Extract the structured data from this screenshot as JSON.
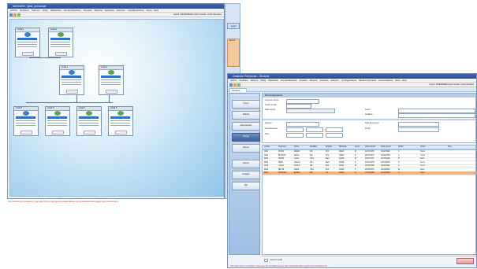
{
  "window1": {
    "title": "Infermiere / gest. personale",
    "menu": [
      "Archivi",
      "Gestione",
      "Stampe",
      "Utility",
      "Statistiche",
      "Amministrazione",
      "Finestre",
      "Ricerca",
      "Gestione",
      "Autorizz.",
      "Configurazione",
      "Aiuto",
      "Esci"
    ],
    "user_info": "Utente: INFERMIERE admin  Canale: Unità Operativa",
    "nodes": [
      {
        "id": "n1",
        "label": "Unità 1"
      },
      {
        "id": "n2",
        "label": "Unità 2"
      },
      {
        "id": "n3",
        "label": "Unità 3"
      },
      {
        "id": "n4",
        "label": "Unità 4"
      },
      {
        "id": "n5",
        "label": "Unità 5"
      },
      {
        "id": "n6",
        "label": "Unità 6"
      },
      {
        "id": "n7",
        "label": "Unità 7"
      },
      {
        "id": "n8",
        "label": "Unità 8"
      }
    ],
    "status": "Per informazioni consultare il manuale  Pronto  Unità gestione  Elaborazione dati completata  Stato aggiornato correttamente"
  },
  "rightcol": {
    "button_label": "Avanti",
    "panel_header": "Elenco"
  },
  "window2": {
    "title": "Gestione Personale - Sezione",
    "menu": [
      "Archivi",
      "Gestione",
      "Stampe",
      "Utility",
      "Statistiche",
      "Amministrazione",
      "Finestre",
      "Ricerca",
      "Gestione",
      "Autorizz.",
      "Configurazione",
      "Modulo Permessi",
      "Comunicazioni",
      "Aiuto",
      "Esci"
    ],
    "user_info": "Utente: INFERMIERE admin  Canale: Unità Operativa",
    "tab": "Gestione personale",
    "nav_buttons": [
      "Nuovo",
      "Modifica",
      "Dati anagrafici",
      "Stampa",
      "Ricerca",
      "Elimina",
      "Dettaglio",
      "Esci"
    ],
    "form": {
      "section_title": "Dati del dipendente",
      "labels": [
        "Cognome Nome",
        "Codice fiscale",
        "Data nascita",
        "Sesso",
        "Qualifica",
        "Reparto",
        "Data assunzione",
        "Inquadramento",
        "Profilo",
        "Note"
      ]
    },
    "grid_columns": [
      "Codice",
      "Cognome",
      "Nome",
      "Qualifica",
      "Reparto",
      "Matricola",
      "Sesso",
      "Data nascita",
      "Data assunz.",
      "Profilo",
      "Orario",
      "Note"
    ],
    "grid_rows": [
      [
        "0001",
        "ROSSI",
        "MARIO",
        "INF",
        "Chir.",
        "10023",
        "M",
        "12/03/1965",
        "01/02/1990",
        "A",
        "Turno",
        ""
      ],
      [
        "0002",
        "BIANCHI",
        "ANNA",
        "INF",
        "Chir.",
        "10024",
        "F",
        "05/07/1970",
        "15/04/1995",
        "A",
        "Turno",
        ""
      ],
      [
        "0003",
        "VERDI",
        "LUCA",
        "OSS",
        "Med.",
        "10025",
        "M",
        "22/11/1972",
        "01/09/1998",
        "B",
        "Giorn.",
        ""
      ],
      [
        "0004",
        "NERI",
        "GIULIA",
        "INF",
        "Med.",
        "10026",
        "F",
        "14/01/1975",
        "10/10/2000",
        "A",
        "Turno",
        ""
      ],
      [
        "0005",
        "GIALLI",
        "PAOLO",
        "INF",
        "Ped.",
        "10027",
        "M",
        "30/06/1968",
        "20/05/1992",
        "A",
        "Turno",
        ""
      ],
      [
        "0006",
        "BRUNI",
        "SARA",
        "OSS",
        "Ped.",
        "10028",
        "F",
        "09/09/1978",
        "03/03/2003",
        "B",
        "Giorn.",
        ""
      ],
      [
        "0007",
        "ROMANO",
        "ELENA",
        "INF",
        "Ort.",
        "10029",
        "F",
        "17/02/1980",
        "01/06/2005",
        "A",
        "Turno",
        ""
      ]
    ],
    "bottom_label": "Record trovati",
    "status": "Per informazioni consultare il manuale  Pronto  Elaborazione dati completata  Stato aggiornato correttamente"
  }
}
